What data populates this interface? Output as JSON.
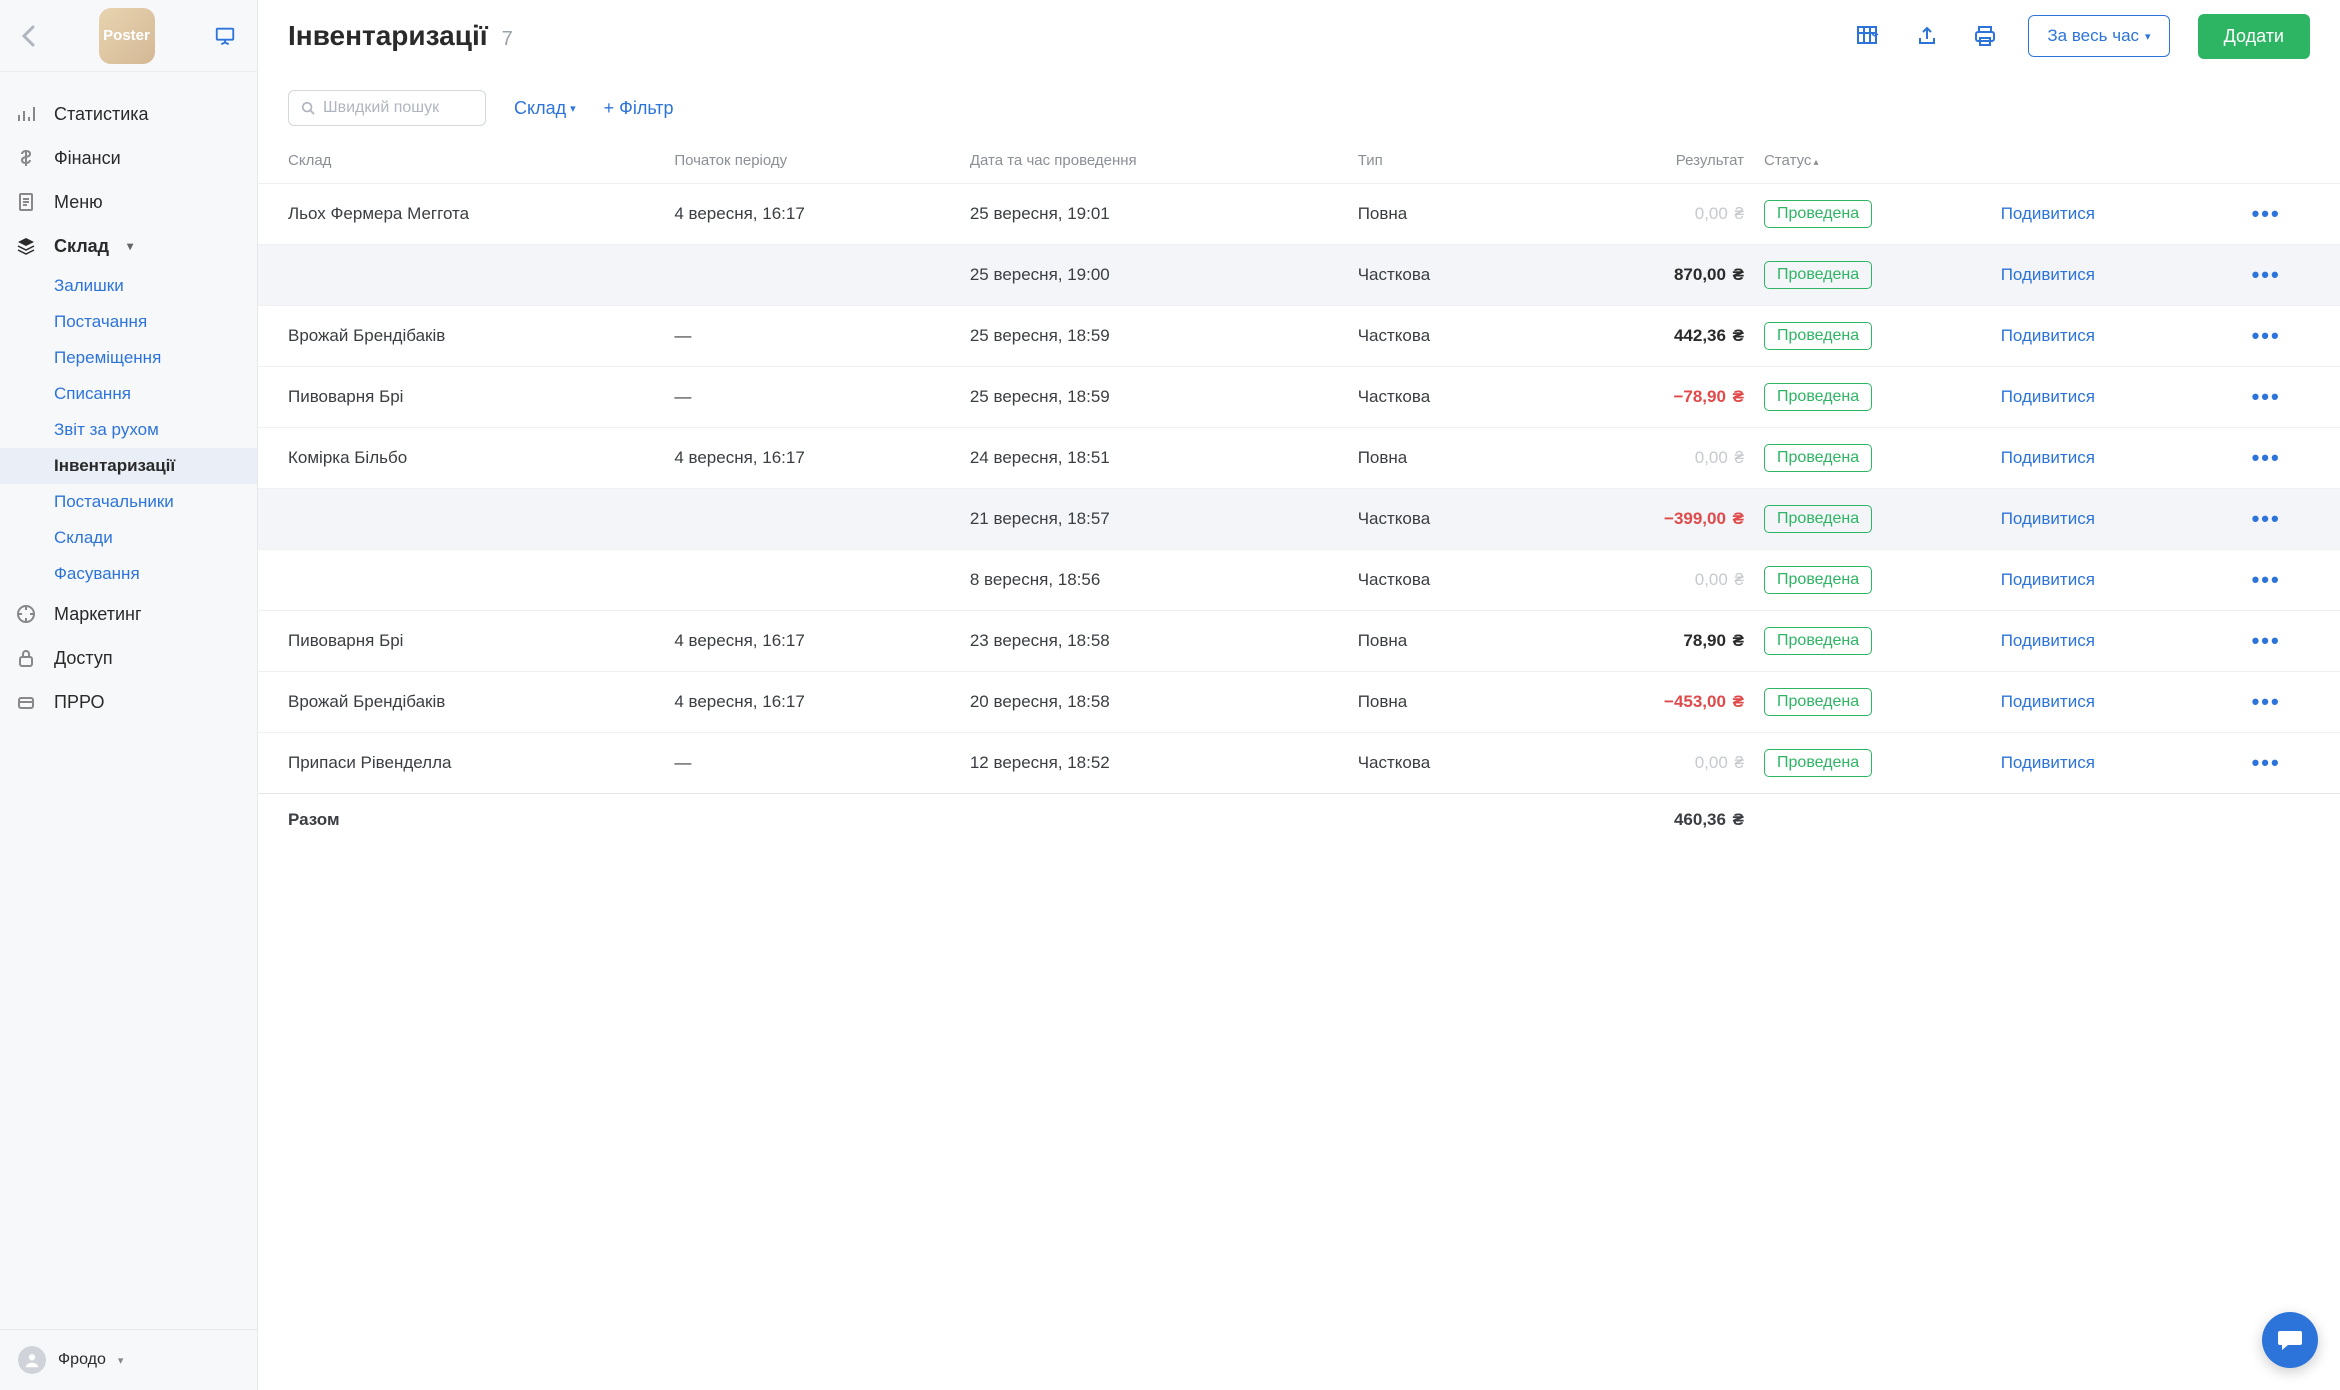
{
  "logo_text": "Poster",
  "sidebar": {
    "items": [
      {
        "label": "Статистика"
      },
      {
        "label": "Фінанси"
      },
      {
        "label": "Меню"
      },
      {
        "label": "Склад"
      },
      {
        "label": "Маркетинг"
      },
      {
        "label": "Доступ"
      },
      {
        "label": "ПРРО"
      }
    ],
    "sub_items": [
      {
        "label": "Залишки"
      },
      {
        "label": "Постачання"
      },
      {
        "label": "Переміщення"
      },
      {
        "label": "Списання"
      },
      {
        "label": "Звіт за рухом"
      },
      {
        "label": "Інвентаризації"
      },
      {
        "label": "Постачальники"
      },
      {
        "label": "Склади"
      },
      {
        "label": "Фасування"
      }
    ],
    "user": "Фродо"
  },
  "header": {
    "title": "Інвентаризації",
    "count": "7",
    "period_btn": "За весь час",
    "add_btn": "Додати"
  },
  "filters": {
    "search_placeholder": "Швидкий пошук",
    "storage_label": "Склад",
    "filter_label": "+ Фільтр"
  },
  "table": {
    "headers": {
      "storage": "Склад",
      "period_start": "Початок періоду",
      "conducted_at": "Дата та час проведення",
      "type": "Тип",
      "result": "Результат",
      "status": "Статус"
    },
    "currency": "₴",
    "rows": [
      {
        "storage": "Льох Фермера Меггота",
        "start": "4 вересня, 16:17",
        "conducted": "25 вересня, 19:01",
        "type": "Повна",
        "result": "0,00",
        "result_kind": "zero",
        "status": "Проведена",
        "view": "Подивитися"
      },
      {
        "storage": "",
        "start": "",
        "conducted": "25 вересня, 19:00",
        "type": "Часткова",
        "result": "870,00",
        "result_kind": "pos",
        "status": "Проведена",
        "view": "Подивитися",
        "selected": true
      },
      {
        "storage": "Врожай Брендібаків",
        "start": "—",
        "conducted": "25 вересня, 18:59",
        "type": "Часткова",
        "result": "442,36",
        "result_kind": "pos",
        "status": "Проведена",
        "view": "Подивитися"
      },
      {
        "storage": "Пивоварня Брі",
        "start": "—",
        "conducted": "25 вересня, 18:59",
        "type": "Часткова",
        "result": "−78,90",
        "result_kind": "neg",
        "status": "Проведена",
        "view": "Подивитися"
      },
      {
        "storage": "Комірка Більбо",
        "start": "4 вересня, 16:17",
        "conducted": "24 вересня, 18:51",
        "type": "Повна",
        "result": "0,00",
        "result_kind": "zero",
        "status": "Проведена",
        "view": "Подивитися"
      },
      {
        "storage": "",
        "start": "",
        "conducted": "21 вересня, 18:57",
        "type": "Часткова",
        "result": "−399,00",
        "result_kind": "neg",
        "status": "Проведена",
        "view": "Подивитися",
        "selected": true
      },
      {
        "storage": "",
        "start": "",
        "conducted": "8 вересня, 18:56",
        "type": "Часткова",
        "result": "0,00",
        "result_kind": "zero",
        "status": "Проведена",
        "view": "Подивитися"
      },
      {
        "storage": "Пивоварня Брі",
        "start": "4 вересня, 16:17",
        "conducted": "23 вересня, 18:58",
        "type": "Повна",
        "result": "78,90",
        "result_kind": "pos",
        "status": "Проведена",
        "view": "Подивитися"
      },
      {
        "storage": "Врожай Брендібаків",
        "start": "4 вересня, 16:17",
        "conducted": "20 вересня, 18:58",
        "type": "Повна",
        "result": "−453,00",
        "result_kind": "neg",
        "status": "Проведена",
        "view": "Подивитися"
      },
      {
        "storage": "Припаси Рівенделла",
        "start": "—",
        "conducted": "12 вересня, 18:52",
        "type": "Часткова",
        "result": "0,00",
        "result_kind": "zero",
        "status": "Проведена",
        "view": "Подивитися"
      }
    ],
    "total_label": "Разом",
    "total_value": "460,36"
  }
}
